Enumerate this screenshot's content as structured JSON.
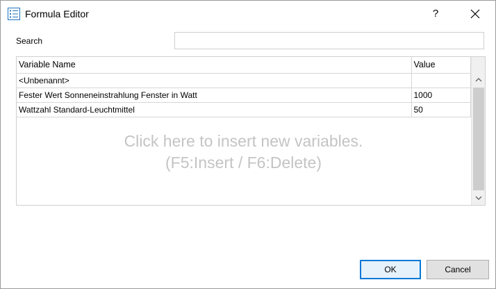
{
  "window": {
    "title": "Formula Editor",
    "help_label": "?",
    "title_icon": "list-icon",
    "close_icon": "close-icon"
  },
  "search": {
    "label": "Search",
    "value": "",
    "placeholder": ""
  },
  "grid": {
    "columns": [
      "Variable Name",
      "Value"
    ],
    "rows": [
      {
        "name": "<Unbenannt>",
        "value": ""
      },
      {
        "name": "Fester Wert Sonneneinstrahlung Fenster in Watt",
        "value": "1000"
      },
      {
        "name": "Wattzahl Standard-Leuchtmittel",
        "value": "50"
      }
    ],
    "placeholder_line1": "Click here to insert new variables.",
    "placeholder_line2": "(F5:Insert / F6:Delete)"
  },
  "buttons": {
    "ok": "OK",
    "cancel": "Cancel"
  },
  "colors": {
    "accent": "#0078d7",
    "title_icon": "#1e73be",
    "placeholder_text": "#c4c4c4"
  }
}
